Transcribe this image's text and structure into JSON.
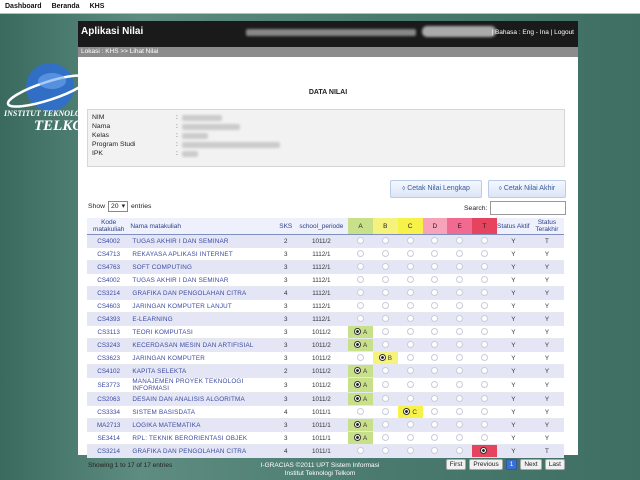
{
  "topnav": [
    "Dashboard",
    "Beranda",
    "KHS"
  ],
  "header": {
    "app_title": "Aplikasi Nilai",
    "links": "| Bahasa : Eng - Ina | Logout"
  },
  "breadcrumb": "Lokasi : KHS >> Lihat Nilai",
  "page_title": "DATA NILAI",
  "info_labels": [
    "NIM",
    "Nama",
    "Kelas",
    "Program Studi",
    "IPK"
  ],
  "buttons": {
    "cetak_lengkap": "Cetak Nilai Lengkap",
    "cetak_akhir": "Cetak Nilai Akhir"
  },
  "show": {
    "label": "Show",
    "value": "20",
    "suffix": "entries"
  },
  "search_label": "Search:",
  "columns": {
    "kode": "Kode matakuliah",
    "nama": "Nama matakuliah",
    "sks": "SKS",
    "periode": "school_periode",
    "grades": [
      "A",
      "B",
      "C",
      "D",
      "E",
      "T"
    ],
    "status_aktif": "Status Aktif",
    "status_terakhir": "Status Terakhir"
  },
  "grade_colors": {
    "A": "#c9e08a",
    "B": "#f5f37c",
    "C": "#f7f24a",
    "D": "#f7a3b9",
    "E": "#f06a92",
    "T": "#e5435e"
  },
  "rows": [
    {
      "kode": "CS4002",
      "nama": "TUGAS AKHIR I DAN SEMINAR",
      "sks": "2",
      "periode": "1011/2",
      "grade": "",
      "aktif": "Y",
      "akhir": "T"
    },
    {
      "kode": "CS4713",
      "nama": "REKAYASA APLIKASI INTERNET",
      "sks": "3",
      "periode": "1112/1",
      "grade": "",
      "aktif": "Y",
      "akhir": "Y"
    },
    {
      "kode": "CS4763",
      "nama": "SOFT COMPUTING",
      "sks": "3",
      "periode": "1112/1",
      "grade": "",
      "aktif": "Y",
      "akhir": "Y"
    },
    {
      "kode": "CS4002",
      "nama": "TUGAS AKHIR I DAN SEMINAR",
      "sks": "3",
      "periode": "1112/1",
      "grade": "",
      "aktif": "Y",
      "akhir": "Y"
    },
    {
      "kode": "CS3214",
      "nama": "GRAFIKA DAN PENGOLAHAN CITRA",
      "sks": "4",
      "periode": "1112/1",
      "grade": "",
      "aktif": "Y",
      "akhir": "Y"
    },
    {
      "kode": "CS4603",
      "nama": "JARINGAN KOMPUTER LANJUT",
      "sks": "3",
      "periode": "1112/1",
      "grade": "",
      "aktif": "Y",
      "akhir": "Y"
    },
    {
      "kode": "CS4393",
      "nama": "E-LEARNING",
      "sks": "3",
      "periode": "1112/1",
      "grade": "",
      "aktif": "Y",
      "akhir": "Y"
    },
    {
      "kode": "CS3113",
      "nama": "TEORI KOMPUTASI",
      "sks": "3",
      "periode": "1011/2",
      "grade": "A",
      "aktif": "Y",
      "akhir": "Y"
    },
    {
      "kode": "CS3243",
      "nama": "KECERDASAN MESIN DAN ARTIFISIAL",
      "sks": "3",
      "periode": "1011/2",
      "grade": "A",
      "aktif": "Y",
      "akhir": "Y"
    },
    {
      "kode": "CS3623",
      "nama": "JARINGAN KOMPUTER",
      "sks": "3",
      "periode": "1011/2",
      "grade": "B",
      "aktif": "Y",
      "akhir": "Y"
    },
    {
      "kode": "CS4102",
      "nama": "KAPITA SELEKTA",
      "sks": "2",
      "periode": "1011/2",
      "grade": "A",
      "aktif": "Y",
      "akhir": "Y"
    },
    {
      "kode": "SE3773",
      "nama": "MANAJEMEN PROYEK TEKNOLOGI INFORMASI",
      "sks": "3",
      "periode": "1011/2",
      "grade": "A",
      "aktif": "Y",
      "akhir": "Y"
    },
    {
      "kode": "CS2063",
      "nama": "DESAIN DAN ANALISIS ALGORITMA",
      "sks": "3",
      "periode": "1011/2",
      "grade": "A",
      "aktif": "Y",
      "akhir": "Y"
    },
    {
      "kode": "CS3334",
      "nama": "SISTEM BASISDATA",
      "sks": "4",
      "periode": "1011/1",
      "grade": "C",
      "aktif": "Y",
      "akhir": "Y"
    },
    {
      "kode": "MA2713",
      "nama": "LOGIKA MATEMATIKA",
      "sks": "3",
      "periode": "1011/1",
      "grade": "A",
      "aktif": "Y",
      "akhir": "Y"
    },
    {
      "kode": "SE3414",
      "nama": "RPL: TEKNIK BERORIENTASI OBJEK",
      "sks": "3",
      "periode": "1011/1",
      "grade": "A",
      "aktif": "Y",
      "akhir": "Y"
    },
    {
      "kode": "CS3214",
      "nama": "GRAFIKA DAN PENGOLAHAN CITRA",
      "sks": "4",
      "periode": "1011/1",
      "grade": "T",
      "aktif": "Y",
      "akhir": "T"
    }
  ],
  "footer_info": "Showing 1 to 17 of 17 entries",
  "pager": [
    "First",
    "Previous",
    "1",
    "Next",
    "Last"
  ],
  "copyright": [
    "I-GRACIAS ©2011 UPT Sistem Informasi",
    "Institut Teknologi Telkom"
  ],
  "logo_text": [
    "INSTITUT TEKNOLOGI",
    "TELKOM"
  ]
}
